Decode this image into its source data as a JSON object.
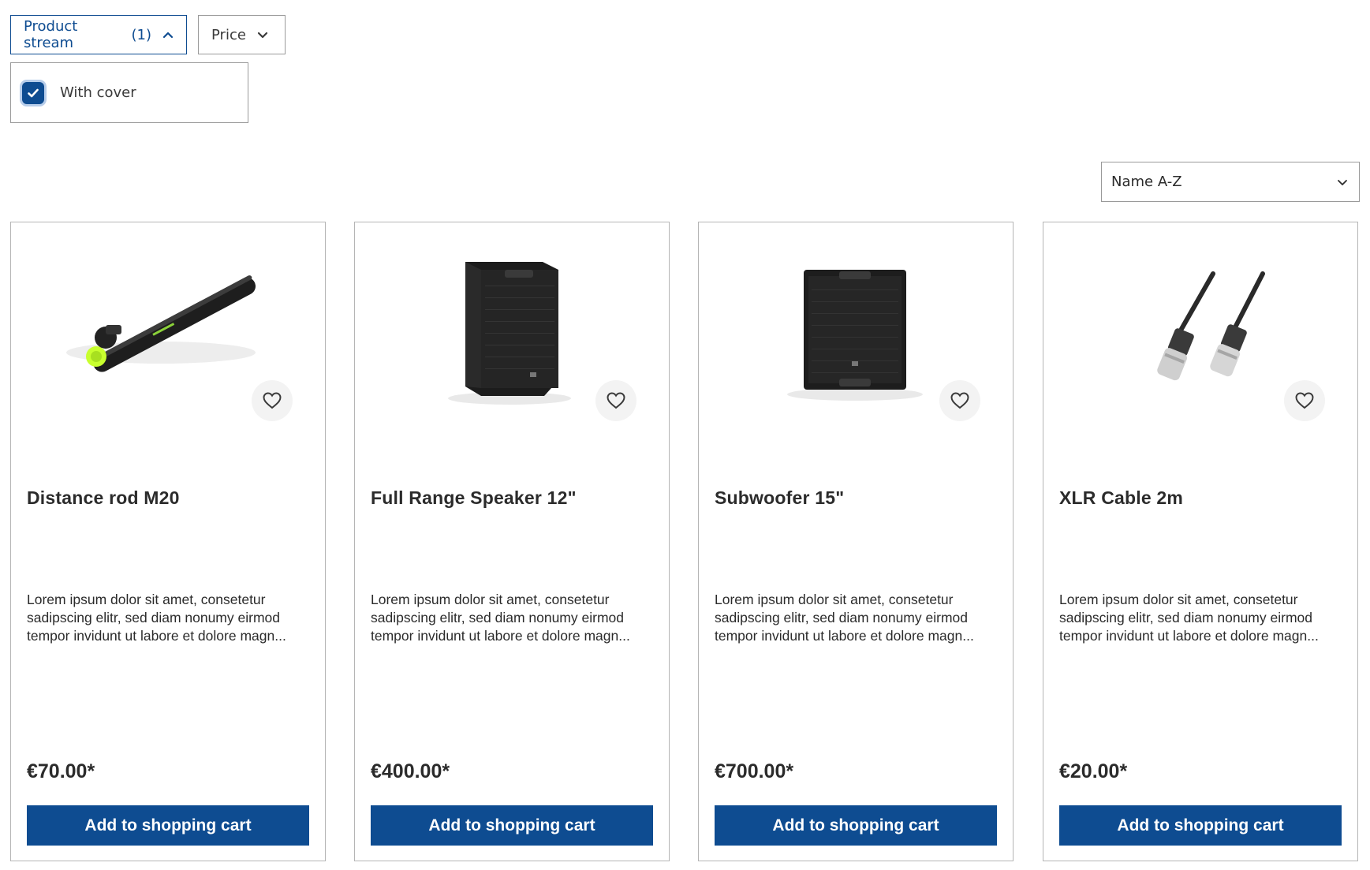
{
  "filters": {
    "product_stream": {
      "label": "Product stream",
      "count": "(1)"
    },
    "price": {
      "label": "Price"
    },
    "stream_options": [
      {
        "label": "With cover",
        "checked": true
      }
    ]
  },
  "sort": {
    "selected": "Name A-Z"
  },
  "products": [
    {
      "name": "Distance rod M20",
      "description": "Lorem ipsum dolor sit amet, consetetur sadipscing elitr, sed diam nonumy eirmod tempor invidunt ut labore et dolore magn...",
      "price": "€70.00*",
      "cta": "Add to shopping cart",
      "image": "distance-rod"
    },
    {
      "name": "Full Range Speaker 12\"",
      "description": "Lorem ipsum dolor sit amet, consetetur sadipscing elitr, sed diam nonumy eirmod tempor invidunt ut labore et dolore magn...",
      "price": "€400.00*",
      "cta": "Add to shopping cart",
      "image": "speaker"
    },
    {
      "name": "Subwoofer 15\"",
      "description": "Lorem ipsum dolor sit amet, consetetur sadipscing elitr, sed diam nonumy eirmod tempor invidunt ut labore et dolore magn...",
      "price": "€700.00*",
      "cta": "Add to shopping cart",
      "image": "subwoofer"
    },
    {
      "name": "XLR Cable 2m",
      "description": "Lorem ipsum dolor sit amet, consetetur sadipscing elitr, sed diam nonumy eirmod tempor invidunt ut labore et dolore magn...",
      "price": "€20.00*",
      "cta": "Add to shopping cart",
      "image": "xlr-cable"
    }
  ],
  "colors": {
    "primary": "#0e4c91",
    "border": "#b5b5b5",
    "text": "#2b2b2b"
  }
}
